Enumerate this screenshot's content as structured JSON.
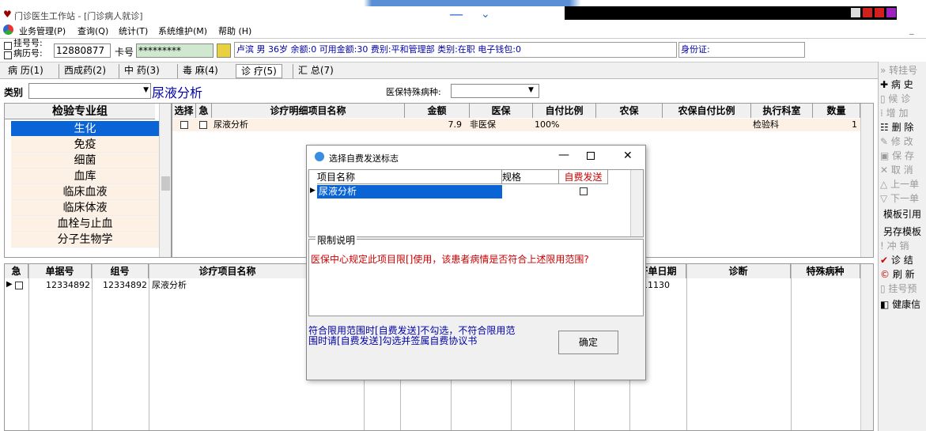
{
  "app": {
    "title": "门诊医生工作站 - [门诊病人就诊]"
  },
  "menu": [
    "业务管理(P)",
    "查询(Q)",
    "统计(T)",
    "系统维护(M)",
    "帮助 (H)"
  ],
  "patient": {
    "reg_label": "挂号号:",
    "record_label": "病历号:",
    "record_no": "12880877",
    "card_label": "卡号",
    "card_value": "*********",
    "info": "卢滨  男  36岁  余额:0  可用金额:30  费别:平和管理部  类别:在职  电子钱包:0",
    "id_label": "身份证:"
  },
  "tabs": [
    "病 历(1)",
    "西成药(2)",
    "中 药(3)",
    "毒 麻(4)",
    "诊 疗(5)",
    "汇 总(7)"
  ],
  "category": {
    "label": "类别",
    "value": "尿液分析",
    "insurance_label": "医保特殊病种:",
    "insurance_value": ""
  },
  "left_list": {
    "header": "检验专业组",
    "items": [
      "生化",
      "免疫",
      "细菌",
      "血库",
      "临床血液",
      "临床体液",
      "血栓与止血",
      "分子生物学"
    ],
    "selected": 0
  },
  "top_table": {
    "headers": [
      "选择",
      "急",
      "诊疗明细项目名称",
      "金额",
      "医保",
      "自付比例",
      "农保",
      "农保自付比例",
      "执行科室",
      "数量"
    ],
    "rows": [
      {
        "name": "尿液分析",
        "amount": "7.9",
        "insurance": "非医保",
        "ratio": "100%",
        "dept": "检验科",
        "qty": "1"
      }
    ]
  },
  "bottom_table": {
    "headers": [
      "急",
      "单据号",
      "组号",
      "诊疗项目名称",
      "开单日期",
      "诊断",
      "特殊病种"
    ],
    "rows": [
      {
        "bill": "12334892",
        "group": "12334892",
        "name": "尿液分析",
        "date": "11130"
      }
    ]
  },
  "right_panel": [
    "转挂号",
    "病 史",
    "候 诊",
    "增 加",
    "删 除",
    "修 改",
    "保 存",
    "取 消",
    "上一单",
    "下一单",
    "模板引用",
    "另存模板",
    "冲 销",
    "诊 结",
    "刷 新",
    "挂号预",
    "健康信"
  ],
  "dialog": {
    "title": "选择自费发送标志",
    "col_name": "项目名称",
    "col_spec": "规格",
    "col_self": "自费发送",
    "row_name": "尿液分析",
    "limit_label": "限制说明",
    "limit_text": "医保中心规定此项目限[]使用，该患者病情是否符合上述限用范围?",
    "hint": "符合限用范围时[自费发送]不勾选，不符合限用范围时请[自费发送]勾选并签属自费协议书",
    "ok": "确定"
  },
  "colors": {
    "selected": "#0a64d6",
    "highlight_row": "#fdf0e4",
    "alert_text": "#c00000",
    "info_text": "#0000aa"
  }
}
